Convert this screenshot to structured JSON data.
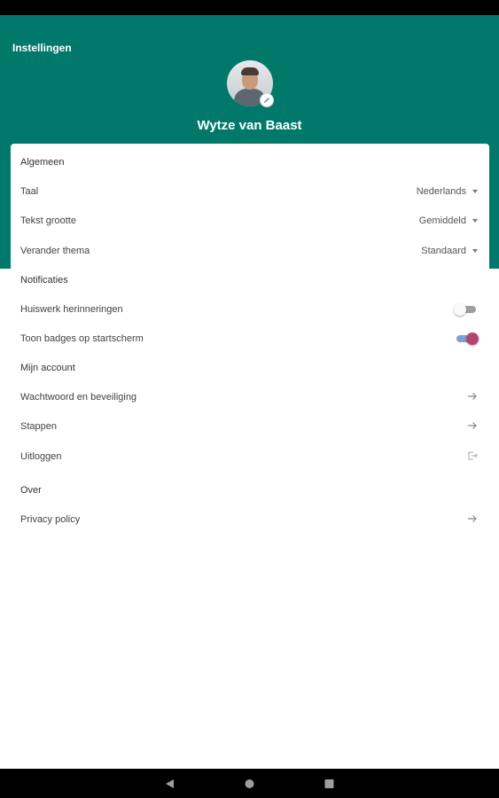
{
  "header": {
    "title": "Instellingen",
    "user_name": "Wytze van Baast"
  },
  "general": {
    "section": "Algemeen",
    "language": {
      "label": "Taal",
      "value": "Nederlands"
    },
    "text_size": {
      "label": "Tekst grootte",
      "value": "Gemiddeld"
    },
    "theme": {
      "label": "Verander thema",
      "value": "Standaard"
    }
  },
  "notifications": {
    "section": "Notificaties",
    "homework": {
      "label": "Huiswerk herinneringen",
      "enabled": false
    },
    "badges": {
      "label": "Toon badges op startscherm",
      "enabled": true
    }
  },
  "account": {
    "section": "Mijn account",
    "password": {
      "label": "Wachtwoord en beveiliging"
    },
    "steps": {
      "label": "Stappen"
    },
    "logout": {
      "label": "Uitloggen"
    }
  },
  "about": {
    "section": "Over",
    "privacy": {
      "label": "Privacy policy"
    }
  },
  "colors": {
    "header_bg": "#00796b",
    "toggle_on_thumb": "#b0476f",
    "toggle_on_track": "#7f9fd8"
  },
  "icons": [
    "pencil-icon",
    "chevron-down-icon",
    "arrow-right-icon",
    "logout-icon",
    "back-icon",
    "home-icon",
    "recents-icon"
  ]
}
